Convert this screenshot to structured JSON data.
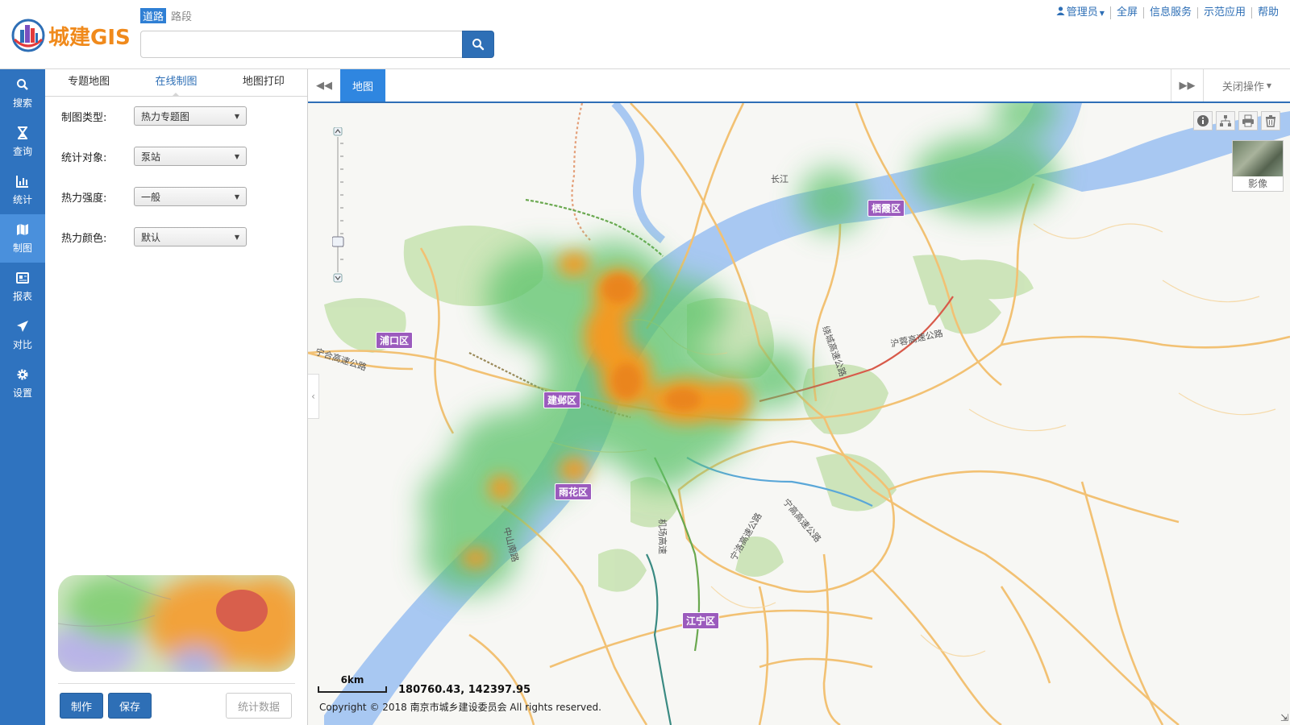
{
  "header": {
    "logo_text": "城建GIS",
    "search_types": [
      "道路",
      "路段"
    ],
    "search_value": "",
    "links": [
      "管理员",
      "全屏",
      "信息服务",
      "示范应用",
      "帮助"
    ]
  },
  "nav": [
    {
      "label": "搜索",
      "icon": "search-icon"
    },
    {
      "label": "查询",
      "icon": "hourglass-icon"
    },
    {
      "label": "统计",
      "icon": "bar-chart-icon"
    },
    {
      "label": "制图",
      "icon": "map-icon"
    },
    {
      "label": "报表",
      "icon": "newspaper-icon"
    },
    {
      "label": "对比",
      "icon": "send-icon"
    },
    {
      "label": "设置",
      "icon": "gear-icon"
    }
  ],
  "nav_active": "制图",
  "panel": {
    "tabs": [
      "专题地图",
      "在线制图",
      "地图打印"
    ],
    "active_tab": "在线制图",
    "fields": [
      {
        "label": "制图类型:",
        "value": "热力专题图"
      },
      {
        "label": "统计对象:",
        "value": "泵站"
      },
      {
        "label": "热力强度:",
        "value": "一般"
      },
      {
        "label": "热力颜色:",
        "value": "默认"
      }
    ],
    "buttons": {
      "make": "制作",
      "save": "保存",
      "stats": "统计数据"
    }
  },
  "map_tabs": {
    "active": "地图",
    "close_ops": "关闭操作"
  },
  "map": {
    "basemap_label": "影像",
    "scale": "6km",
    "coordinates": "180760.43, 142397.95",
    "copyright": "Copyright © 2018 南京市城乡建设委员会 All rights reserved.",
    "districts": [
      "浦口区",
      "栖霞区",
      "建邺区",
      "雨花区",
      "江宁区"
    ],
    "labels": [
      "长江",
      "宁合高速公路",
      "沪蓉高速公路",
      "绕城高速公路",
      "机场高速",
      "宁洛高速公路",
      "中山南路",
      "宁高高速公路"
    ]
  },
  "colors": {
    "accent": "#2e6fb6",
    "nav_bg": "#2f73bf",
    "nav_active": "#4a90dc",
    "logo": "#f08a1c",
    "district": "#9b5bbd",
    "heat_core": "#f08a1c",
    "heat_edge": "#5cc36a"
  }
}
